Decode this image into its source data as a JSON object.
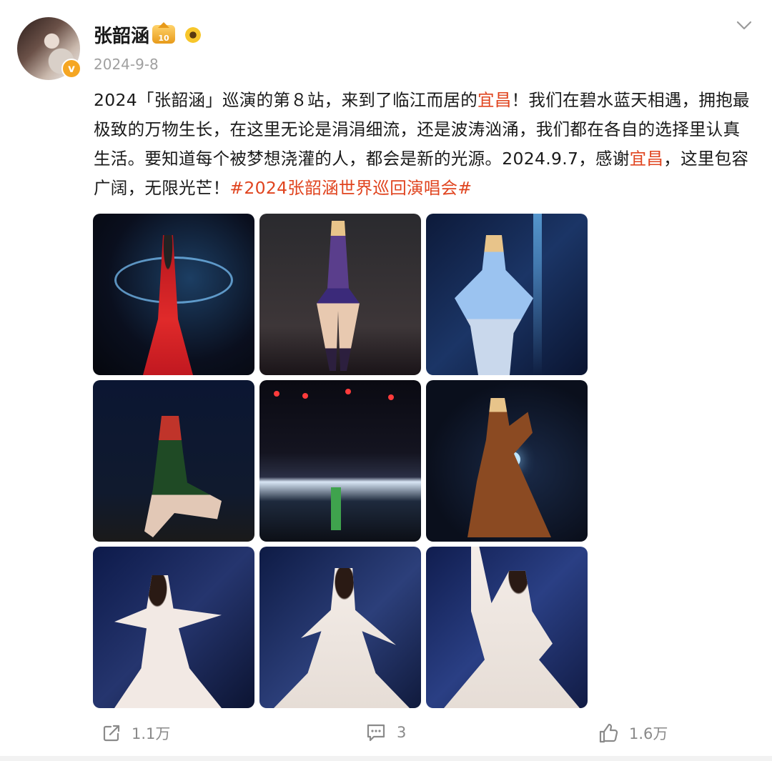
{
  "post": {
    "author": "张韶涵",
    "date": "2024-9-8",
    "text_parts": {
      "p1": "2024「张韶涵」巡演的第８站，来到了临江而居的",
      "city1": "宜昌",
      "p2": "！我们在碧水蓝天相遇，拥抱最极致的万物生长，在这里无论是涓涓细流，还是波涛汹涌，我们都在各自的选择里认真生活。要知道每个被梦想浇灌的人，都会是新的光源。2024.9.7，感谢",
      "city2": "宜昌",
      "p3": "，这里包容广阔，无限光芒！",
      "hashtag": "#2024张韶涵世界巡回演唱会#"
    },
    "badge_level": "10"
  },
  "actions": {
    "repost_count": "1.1万",
    "comment_count": "3",
    "like_count": "1.6万"
  },
  "icons": [
    "chevron-down-icon",
    "verified-icon",
    "repost-icon",
    "comment-icon",
    "like-icon"
  ],
  "colors": {
    "highlight": "#e0441f",
    "muted": "#8a8a8a",
    "badge": "#f5a623"
  },
  "photos": [
    "red-gown-photo",
    "purple-outfit-photo",
    "blue-feather-photo",
    "green-dress-photo",
    "crowd-stage-photo",
    "brown-gown-photo",
    "white-dress-photo-1",
    "white-dress-photo-2",
    "white-dress-photo-3"
  ]
}
